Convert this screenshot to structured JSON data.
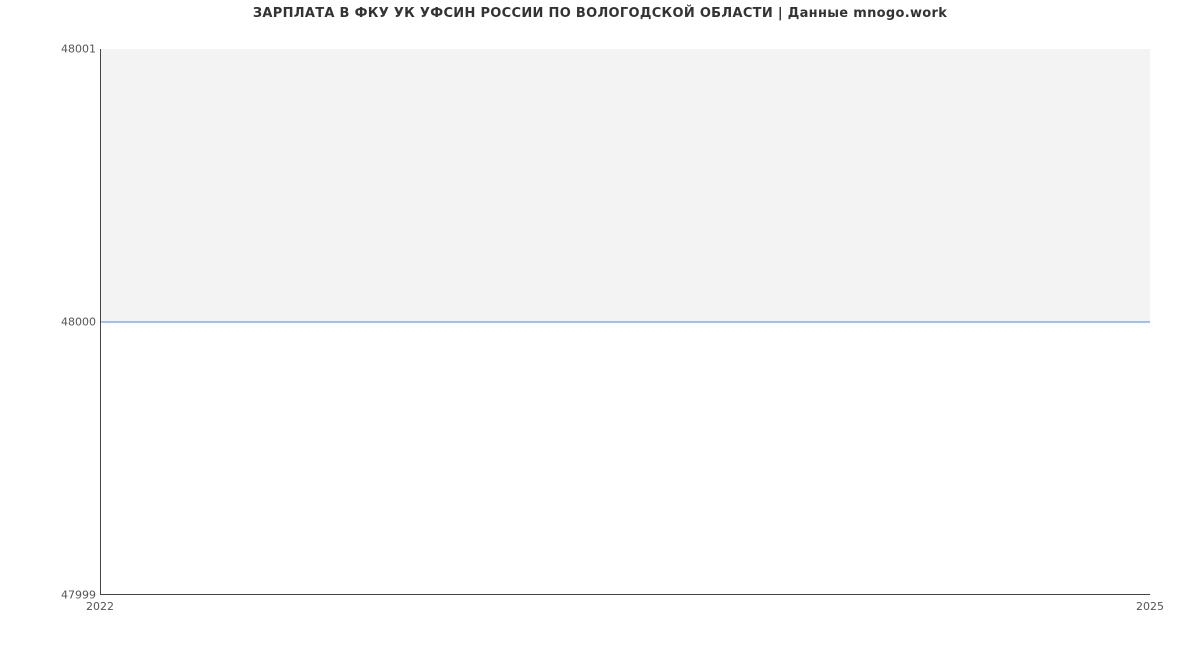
{
  "chart_data": {
    "type": "line",
    "title": "ЗАРПЛАТА В ФКУ УК УФСИН РОССИИ ПО ВОЛОГОДСКОЙ ОБЛАСТИ | Данные mnogo.work",
    "xlabel": "",
    "ylabel": "",
    "x": [
      2022,
      2025
    ],
    "values": [
      48000,
      48000
    ],
    "xlim": [
      2022,
      2025
    ],
    "ylim": [
      47999,
      48001
    ],
    "x_ticks": [
      "2022",
      "2025"
    ],
    "y_ticks": [
      "47999",
      "48000",
      "48001"
    ]
  }
}
